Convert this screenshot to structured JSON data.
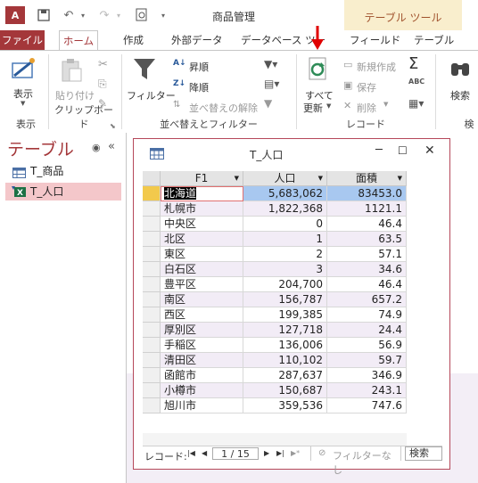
{
  "app": {
    "logo": "A",
    "title": "商品管理",
    "context_tools": "テーブル ツール"
  },
  "tabs": [
    "ファイル",
    "ホーム",
    "作成",
    "外部データ",
    "データベース ツー",
    "フィールド",
    "テーブル"
  ],
  "ribbon": {
    "view": {
      "label": "表示",
      "group": "表示"
    },
    "clipboard": {
      "paste": "貼り付け",
      "group": "クリップボード"
    },
    "sort": {
      "filter": "フィルター",
      "asc": "昇順",
      "desc": "降順",
      "remove_sort": "並べ替えの解除",
      "group": "並べ替えとフィルター"
    },
    "records": {
      "refresh_line1": "すべて",
      "refresh_line2": "更新",
      "new": "新規作成",
      "save": "保存",
      "delete": "削除",
      "group": "レコード"
    },
    "find": {
      "label": "検索",
      "group": "検"
    }
  },
  "nav": {
    "title": "テーブル",
    "items": [
      "T_商品",
      "T_人口"
    ]
  },
  "datasheet": {
    "title": "T_人口",
    "columns": [
      "F1",
      "人口",
      "面積"
    ],
    "rows": [
      [
        "北海道",
        "5,683,062",
        "83453.0"
      ],
      [
        "札幌市",
        "1,822,368",
        "1121.1"
      ],
      [
        "中央区",
        "0",
        "46.4"
      ],
      [
        "北区",
        "1",
        "63.5"
      ],
      [
        "東区",
        "2",
        "57.1"
      ],
      [
        "白石区",
        "3",
        "34.6"
      ],
      [
        "豊平区",
        "204,700",
        "46.4"
      ],
      [
        "南区",
        "156,787",
        "657.2"
      ],
      [
        "西区",
        "199,385",
        "74.9"
      ],
      [
        "厚別区",
        "127,718",
        "24.4"
      ],
      [
        "手稲区",
        "136,006",
        "56.9"
      ],
      [
        "清田区",
        "110,102",
        "59.7"
      ],
      [
        "函館市",
        "287,637",
        "346.9"
      ],
      [
        "小樽市",
        "150,687",
        "243.1"
      ],
      [
        "旭川市",
        "359,536",
        "747.6"
      ]
    ],
    "status": {
      "label": "レコード:",
      "position": "1 / 15",
      "filter": "フィルターなし",
      "search": "検索"
    }
  },
  "colors": {
    "accent": "#a4373a",
    "selected_row": "#a8c8f0",
    "arrow": "#e00000"
  }
}
